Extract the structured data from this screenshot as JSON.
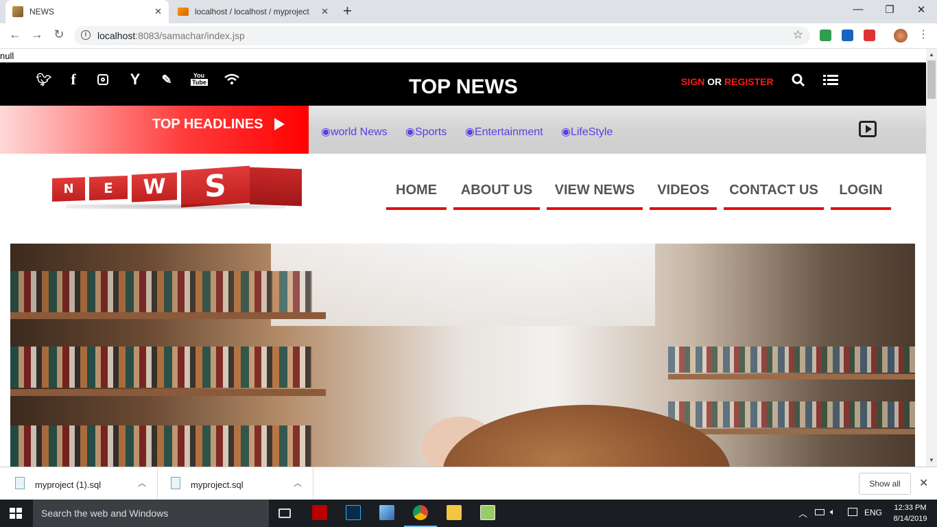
{
  "browser": {
    "tabs": [
      {
        "title": "NEWS",
        "active": true
      },
      {
        "title": "localhost / localhost / myproject",
        "active": false
      }
    ],
    "new_tab_label": "+",
    "window_controls": {
      "minimize": "—",
      "maximize": "❐",
      "close": "✕"
    },
    "address": {
      "host": "localhost",
      "rest": ":8083/samachar/index.jsp"
    },
    "icons": [
      "back-icon",
      "forward-icon",
      "reload-icon",
      "info-icon",
      "bookmark-star-icon"
    ]
  },
  "page": {
    "null_text": "null",
    "topbar": {
      "title": "TOP NEWS",
      "sign": "SIGN",
      "or": "OR",
      "register": "REGISTER",
      "social_icons": [
        "twitter-icon",
        "facebook-icon",
        "instagram-icon",
        "cocktail-icon",
        "pencil-icon",
        "youtube-icon",
        "wifi-icon"
      ]
    },
    "headlines": {
      "title": "TOP HEADLINES",
      "links": [
        "◉world News",
        "◉Sports",
        "◉Entertainment",
        "◉LifeStyle"
      ]
    },
    "logo_letters": [
      "N",
      "E",
      "W",
      "S"
    ],
    "nav": [
      "HOME",
      "ABOUT US",
      "VIEW NEWS",
      "VIDEOS",
      "CONTACT US",
      "LOGIN"
    ],
    "colors": {
      "accent_red": "#e01010",
      "link_purple": "#5a3de6"
    }
  },
  "downloads": {
    "items": [
      "myproject (1).sql",
      "myproject.sql"
    ],
    "show_all": "Show all"
  },
  "taskbar": {
    "search_placeholder": "Search the web and Windows",
    "language": "ENG",
    "time": "12:33 PM",
    "date": "8/14/2019"
  }
}
